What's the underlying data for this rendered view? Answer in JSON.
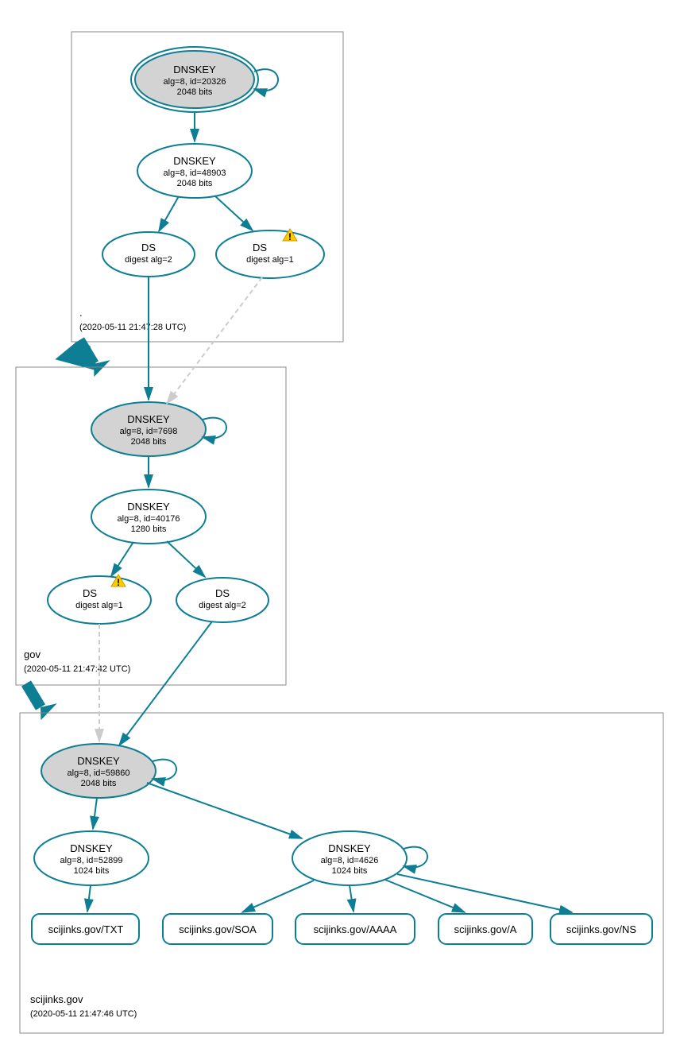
{
  "colors": {
    "accent": "#0d7e93",
    "grey_fill": "#d3d3d3",
    "warn": "#ffcc00"
  },
  "zones": {
    "root": {
      "label": ".",
      "timestamp": "(2020-05-11 21:47:28 UTC)",
      "nodes": {
        "dnskey1": {
          "t1": "DNSKEY",
          "t2": "alg=8, id=20326",
          "t3": "2048 bits"
        },
        "dnskey2": {
          "t1": "DNSKEY",
          "t2": "alg=8, id=48903",
          "t3": "2048 bits"
        },
        "ds1": {
          "t1": "DS",
          "t2": "digest alg=2"
        },
        "ds2": {
          "t1": "DS",
          "t2": "digest alg=1",
          "warn": true
        }
      }
    },
    "gov": {
      "label": "gov",
      "timestamp": "(2020-05-11 21:47:42 UTC)",
      "nodes": {
        "dnskey1": {
          "t1": "DNSKEY",
          "t2": "alg=8, id=7698",
          "t3": "2048 bits"
        },
        "dnskey2": {
          "t1": "DNSKEY",
          "t2": "alg=8, id=40176",
          "t3": "1280 bits"
        },
        "ds1": {
          "t1": "DS",
          "t2": "digest alg=1",
          "warn": true
        },
        "ds2": {
          "t1": "DS",
          "t2": "digest alg=2"
        }
      }
    },
    "scijinks": {
      "label": "scijinks.gov",
      "timestamp": "(2020-05-11 21:47:46 UTC)",
      "nodes": {
        "dnskey1": {
          "t1": "DNSKEY",
          "t2": "alg=8, id=59860",
          "t3": "2048 bits"
        },
        "dnskey2": {
          "t1": "DNSKEY",
          "t2": "alg=8, id=52899",
          "t3": "1024 bits"
        },
        "dnskey3": {
          "t1": "DNSKEY",
          "t2": "alg=8, id=4626",
          "t3": "1024 bits"
        }
      },
      "records": {
        "txt": "scijinks.gov/TXT",
        "soa": "scijinks.gov/SOA",
        "aaaa": "scijinks.gov/AAAA",
        "a": "scijinks.gov/A",
        "ns": "scijinks.gov/NS"
      }
    }
  }
}
